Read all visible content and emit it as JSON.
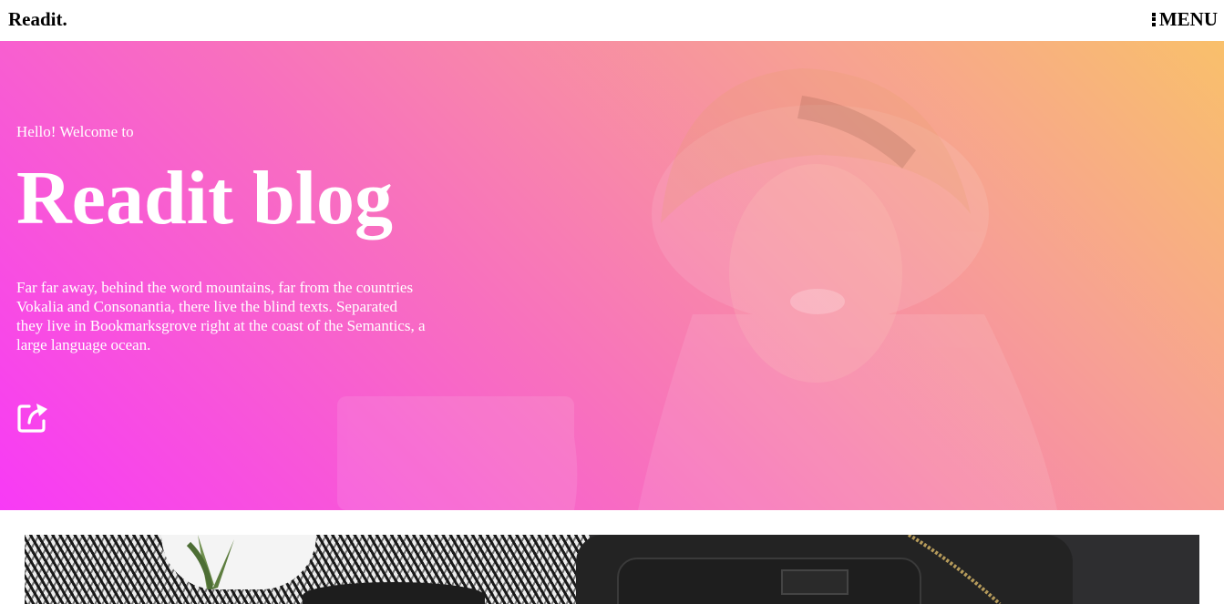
{
  "navbar": {
    "brand": "Readit.",
    "menu_label": "MENU",
    "menu_icon": "vertical-dots-icon"
  },
  "hero": {
    "subheading": "Hello! Welcome to",
    "title": "Readit blog",
    "description": "Far far away, behind the word mountains, far from the countries Vokalia and Consonantia, there live the blind texts. Separated they live in Bookmarksgrove right at the coast of the Semantics, a large language ocean.",
    "link_icon": "external-link-icon",
    "gradient_colors": [
      "#f83af6",
      "#f86fbf",
      "#f7a193",
      "#f9c06b"
    ]
  }
}
